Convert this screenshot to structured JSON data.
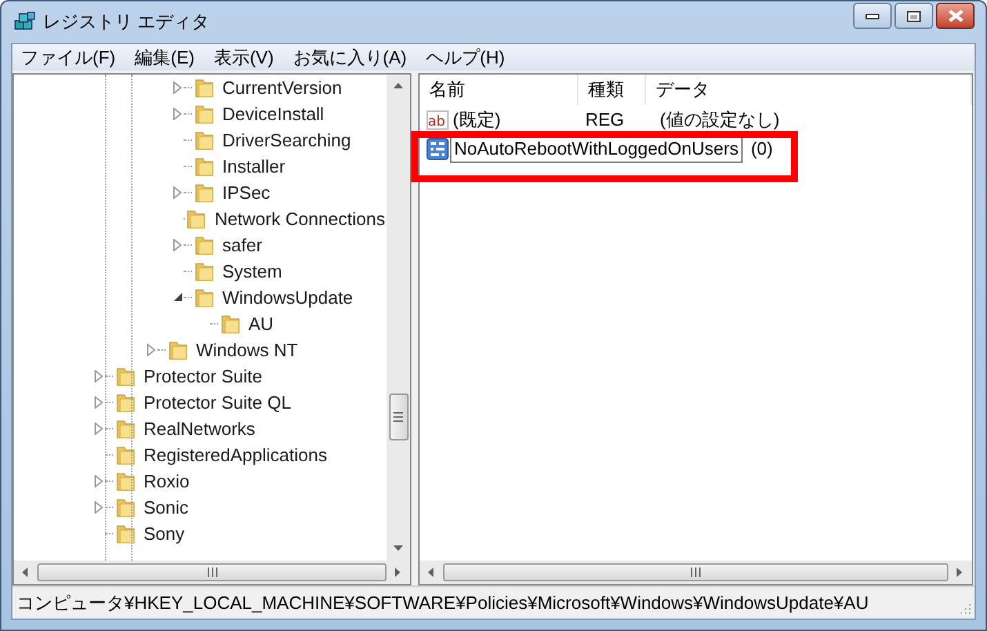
{
  "window": {
    "title": "レジストリ エディタ"
  },
  "menu": [
    "ファイル(F)",
    "編集(E)",
    "表示(V)",
    "お気に入り(A)",
    "ヘルプ(H)"
  ],
  "tree": [
    {
      "children": [
        {
          "children": [
            {
              "children": [
                {
                  "label": "CurrentVersion",
                  "has_children": true,
                  "expanded": false
                },
                {
                  "label": "DeviceInstall",
                  "has_children": true,
                  "expanded": false
                },
                {
                  "label": "DriverSearching",
                  "has_children": false
                },
                {
                  "label": "Installer",
                  "has_children": false
                },
                {
                  "label": "IPSec",
                  "has_children": true,
                  "expanded": false
                },
                {
                  "label": "Network Connections",
                  "has_children": false
                },
                {
                  "label": "safer",
                  "has_children": true,
                  "expanded": false
                },
                {
                  "label": "System",
                  "has_children": false
                },
                {
                  "label": "WindowsUpdate",
                  "has_children": true,
                  "expanded": true,
                  "children": [
                    {
                      "label": "AU",
                      "has_children": false
                    }
                  ]
                }
              ]
            },
            {
              "label": "Windows NT",
              "has_children": true,
              "expanded": false
            }
          ]
        }
      ]
    },
    {
      "label": "Protector Suite",
      "has_children": true,
      "expanded": false
    },
    {
      "label": "Protector Suite QL",
      "has_children": true,
      "expanded": false
    },
    {
      "label": "RealNetworks",
      "has_children": true,
      "expanded": false
    },
    {
      "label": "RegisteredApplications",
      "has_children": false
    },
    {
      "label": "Roxio",
      "has_children": true,
      "expanded": false
    },
    {
      "label": "Sonic",
      "has_children": true,
      "expanded": false
    },
    {
      "label": "Sony",
      "has_children": false
    }
  ],
  "values": {
    "columns": [
      "名前",
      "種類",
      "データ"
    ],
    "rows": [
      {
        "kind": "string",
        "icon_label": "ab",
        "name": "(既定)",
        "type": "REG",
        "data": "(値の設定なし)",
        "editing": false
      },
      {
        "kind": "binary",
        "name": "NoAutoRebootWithLoggedOnUsers",
        "data": "(0)",
        "editing": true,
        "highlighted": true
      }
    ]
  },
  "status_bar": "コンピュータ¥HKEY_LOCAL_MACHINE¥SOFTWARE¥Policies¥Microsoft¥Windows¥WindowsUpdate¥AU"
}
